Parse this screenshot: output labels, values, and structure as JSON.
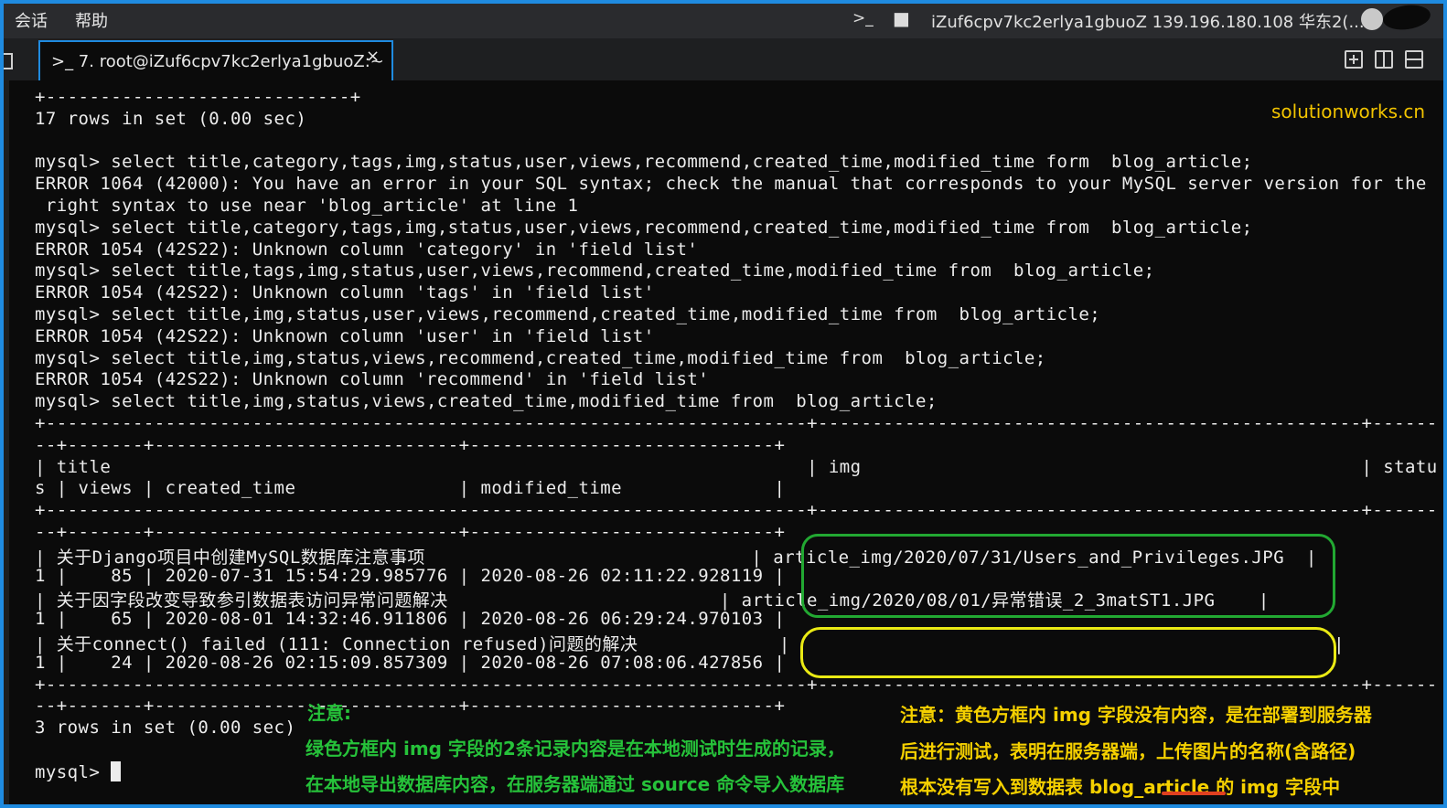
{
  "menu": {
    "session": "会话",
    "help": "帮助"
  },
  "titlebar": {
    "connection": "iZuf6cpv7kc2erlya1gbuoZ 139.196.180.108 华东2(..."
  },
  "tab": {
    "label": ">_ 7. root@iZuf6cpv7kc2erlya1gbuoZ:~",
    "close": "×"
  },
  "watermark": "solutionworks.cn",
  "terminal": {
    "lines": [
      "+----------------------------+",
      "17 rows in set (0.00 sec)",
      "",
      "mysql> select title,category,tags,img,status,user,views,recommend,created_time,modified_time form  blog_article;",
      "ERROR 1064 (42000): You have an error in your SQL syntax; check the manual that corresponds to your MySQL server version for the",
      " right syntax to use near 'blog_article' at line 1",
      "mysql> select title,category,tags,img,status,user,views,recommend,created_time,modified_time from  blog_article;",
      "ERROR 1054 (42S22): Unknown column 'category' in 'field list'",
      "mysql> select title,tags,img,status,user,views,recommend,created_time,modified_time from  blog_article;",
      "ERROR 1054 (42S22): Unknown column 'tags' in 'field list'",
      "mysql> select title,img,status,user,views,recommend,created_time,modified_time from  blog_article;",
      "ERROR 1054 (42S22): Unknown column 'user' in 'field list'",
      "mysql> select title,img,status,views,recommend,created_time,modified_time from  blog_article;",
      "ERROR 1054 (42S22): Unknown column 'recommend' in 'field list'",
      "mysql> select title,img,status,views,created_time,modified_time from  blog_article;",
      "+----------------------------------------------------------------------+--------------------------------------------------+------",
      "--+-------+----------------------------+----------------------------+",
      "| title                                                                | img                                              | statu",
      "s | views | created_time               | modified_time              |",
      "+----------------------------------------------------------------------+--------------------------------------------------+------",
      "--+-------+----------------------------+----------------------------+",
      "| 关于Django项目中创建MySQL数据库注意事项                              | article_img/2020/07/31/Users_and_Privileges.JPG  |",
      "1 |    85 | 2020-07-31 15:54:29.985776 | 2020-08-26 02:11:22.928119 |",
      "| 关于因字段改变导致参引数据表访问异常问题解决                         | article_img/2020/08/01/异常错误_2_3matST1.JPG    |",
      "1 |    65 | 2020-08-01 14:32:46.911806 | 2020-08-26 06:29:24.970103 |",
      "| 关于connect() failed (111: Connection refused)问题的解决             |                                                  |",
      "1 |    24 | 2020-08-26 02:15:09.857309 | 2020-08-26 07:08:06.427856 |",
      "+----------------------------------------------------------------------+--------------------------------------------------+------",
      "--+-------+----------------------------+----------------------------+",
      "3 rows in set (0.00 sec)",
      "",
      "mysql> "
    ]
  },
  "notes": {
    "green_title": "注意:",
    "green_1": "绿色方框内 img 字段的2条记录内容是在本地测试时生成的记录，",
    "green_2": "在本地导出数据库内容，在服务器端通过 source 命令导入数据库",
    "yellow_1": "注意：黄色方框内 img 字段没有内容，是在部署到服务器",
    "yellow_2": "后进行测试，表明在服务器端，上传图片的名称(含路径)",
    "yellow_3": "根本没有写入到数据表 blog_article 的 img 字段中"
  },
  "colors": {
    "accent": "#1f8be0",
    "green_box": "#22a832",
    "yellow_box": "#eaea14",
    "watermark": "#f2c400"
  }
}
